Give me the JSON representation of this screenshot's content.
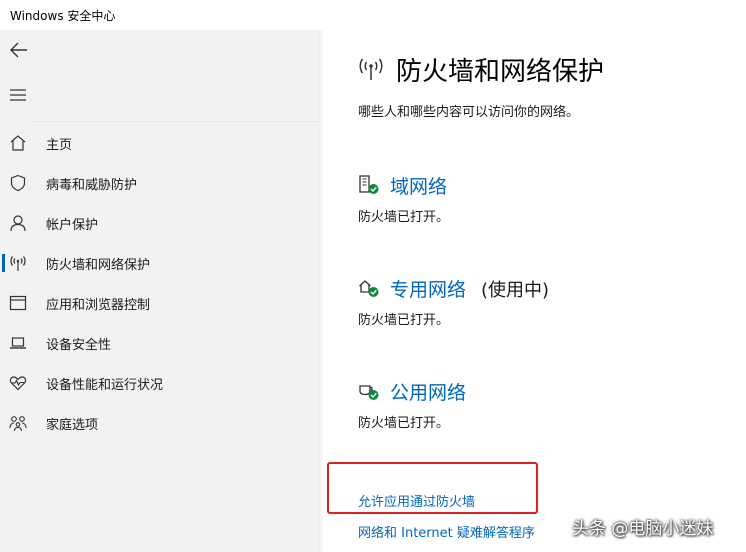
{
  "window": {
    "title": "Windows 安全中心"
  },
  "sidebar": {
    "back_icon": "back-arrow-icon",
    "menu_icon": "hamburger-menu-icon",
    "items": [
      {
        "label": "主页",
        "icon": "home-icon",
        "active": false
      },
      {
        "label": "病毒和威胁防护",
        "icon": "shield-icon",
        "active": false
      },
      {
        "label": "帐户保护",
        "icon": "person-icon",
        "active": false
      },
      {
        "label": "防火墙和网络保护",
        "icon": "wireless-antenna-icon",
        "active": true
      },
      {
        "label": "应用和浏览器控制",
        "icon": "browser-window-icon",
        "active": false
      },
      {
        "label": "设备安全性",
        "icon": "laptop-icon",
        "active": false
      },
      {
        "label": "设备性能和运行状况",
        "icon": "heart-pulse-icon",
        "active": false
      },
      {
        "label": "家庭选项",
        "icon": "family-icon",
        "active": false
      }
    ]
  },
  "main": {
    "title": "防火墙和网络保护",
    "subtitle": "哪些人和哪些内容可以访问你的网络。",
    "networks": [
      {
        "name": "域网络",
        "suffix": "",
        "status": "防火墙已打开。",
        "icon": "domain-building-icon"
      },
      {
        "name": "专用网络",
        "suffix": "(使用中)",
        "status": "防火墙已打开。",
        "icon": "private-home-network-icon"
      },
      {
        "name": "公用网络",
        "suffix": "",
        "status": "防火墙已打开。",
        "icon": "public-coffee-network-icon"
      }
    ],
    "links": {
      "allow_app": "允许应用通过防火墙",
      "troubleshooter": "网络和 Internet 疑难解答程序"
    }
  },
  "watermark": "头条 @电脑小迷妹",
  "colors": {
    "accent": "#0067c0",
    "ok_green": "#10893e",
    "highlight": "#e02020",
    "sidebar_bg": "#f2f2f2"
  }
}
